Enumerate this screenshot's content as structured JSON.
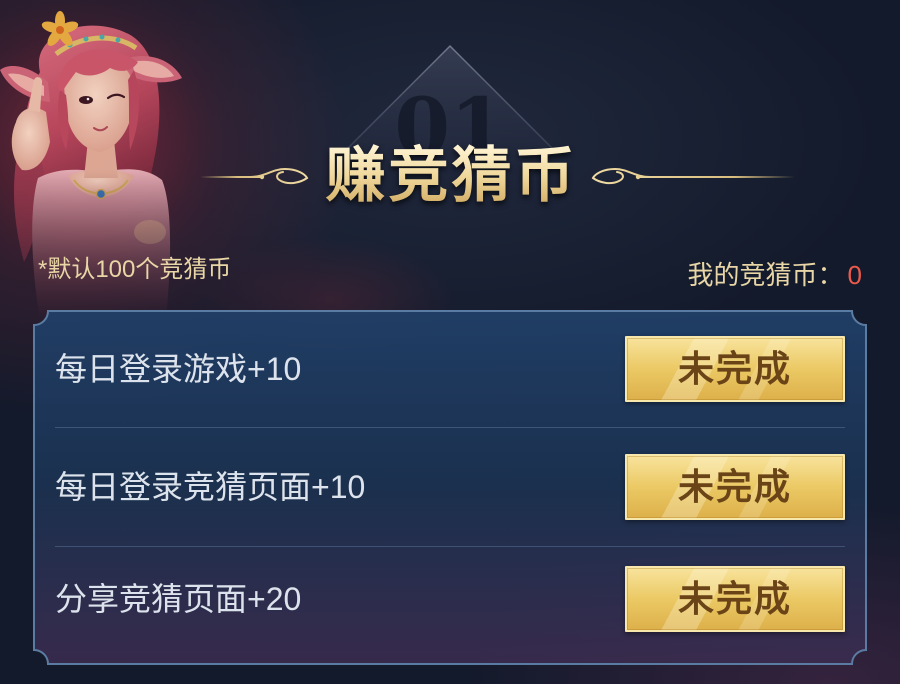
{
  "header": {
    "number": "01",
    "title": "赚竞猜币"
  },
  "info": {
    "default_note": "*默认100个竞猜币",
    "my_coins_label": "我的竞猜币：",
    "my_coins_value": "0"
  },
  "tasks": [
    {
      "label": "每日登录游戏+10",
      "button_label": "未完成"
    },
    {
      "label": "每日登录竞猜页面+10",
      "button_label": "未完成"
    },
    {
      "label": "分享竞猜页面+20",
      "button_label": "未完成"
    }
  ],
  "icons": {
    "character": "character-portrait",
    "number_badge": "diamond-badge-icon",
    "title_ornament_left": "swirl-ornament-left-icon",
    "title_ornament_right": "swirl-ornament-right-icon"
  },
  "colors": {
    "background": "#131a2b",
    "title_gold": "#f0d89c",
    "note_text": "#e9d6a6",
    "coin_value": "#ec5a4c",
    "task_text": "#dde3ec",
    "panel_border": "#5b7ca2",
    "button_gold": "#ebc964",
    "button_text": "#6a4417"
  }
}
